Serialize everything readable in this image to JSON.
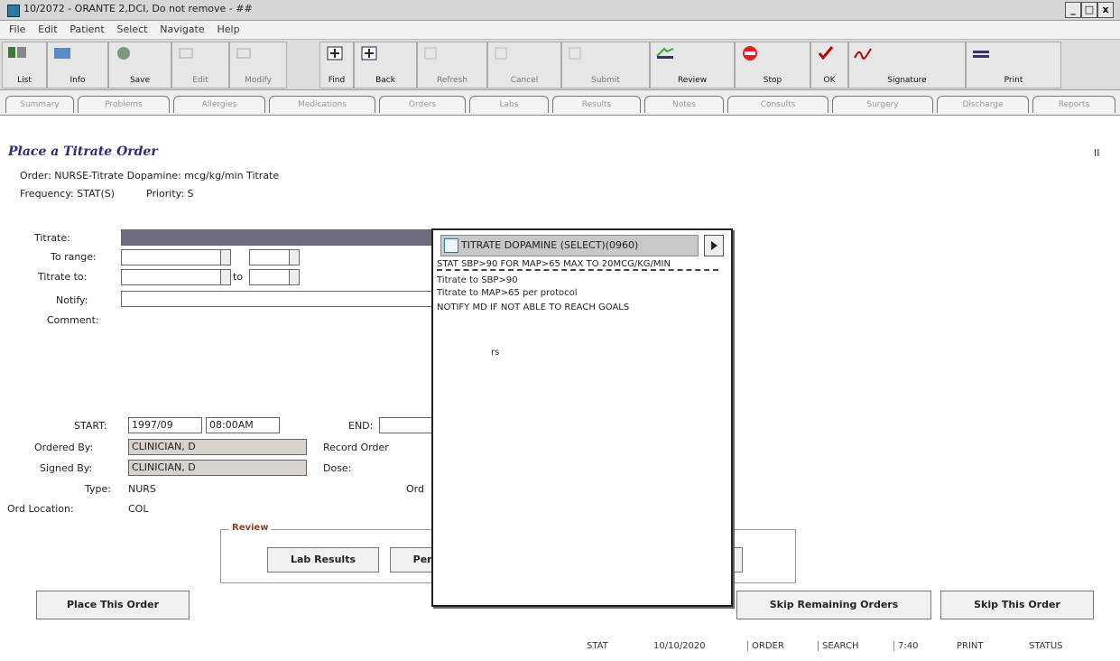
{
  "window": {
    "title": "10/2072 - ORANTE 2,DCI, Do not remove - ##",
    "min": "_",
    "max": "□",
    "close": "x"
  },
  "menu": [
    "File",
    "Edit",
    "Patient",
    "Select",
    "Navigate",
    "Help"
  ],
  "toolbar": [
    {
      "label": "List",
      "icon": "list-icon",
      "enabled": true
    },
    {
      "label": "Info",
      "icon": "info-icon",
      "enabled": true
    },
    {
      "label": "Save",
      "icon": "save-icon",
      "enabled": true
    },
    {
      "label": "Edit",
      "icon": "edit-icon",
      "enabled": false
    },
    {
      "label": "Modify",
      "icon": "modify-icon",
      "enabled": false
    },
    {
      "label": "Find",
      "icon": "find-icon",
      "enabled": true
    },
    {
      "label": "Back",
      "icon": "back-icon",
      "enabled": true
    },
    {
      "label": "Refresh",
      "icon": "refresh-icon",
      "enabled": false
    },
    {
      "label": "Cancel",
      "icon": "cancel-icon",
      "enabled": false
    },
    {
      "label": "Submit",
      "icon": "submit-icon",
      "enabled": false
    },
    {
      "label": "Review",
      "icon": "review-icon",
      "enabled": true
    },
    {
      "label": "Stop",
      "icon": "stop-icon",
      "enabled": true
    },
    {
      "label": "OK",
      "icon": "check-ok-icon",
      "enabled": true
    },
    {
      "label": "Signature",
      "icon": "signature-icon",
      "enabled": true
    },
    {
      "label": "Print",
      "icon": "print-icon",
      "enabled": true
    }
  ],
  "tabs": [
    "Summary",
    "Problems",
    "Allergies",
    "Medications",
    "Orders",
    "Labs",
    "Results",
    "Notes",
    "Consults",
    "Surgery",
    "Discharge",
    "Reports"
  ],
  "order": {
    "page_title": "Place a Titrate Order",
    "order_line": "Order: NURSE-Titrate Dopamine: mcg/kg/min Titrate",
    "frequency_line": "Frequency: STAT(S)          Priority: S",
    "page_marker": "II",
    "labels": {
      "titrate": "Titrate:",
      "to_range": "To range:",
      "titrate_to": "Titrate to:",
      "notify": "Notify:",
      "comment": "Comment:",
      "start": "START:",
      "end": "END:",
      "ordered_by": "Ordered By:",
      "signed_by": "Signed By:",
      "dose": "Dose:",
      "type": "Type:",
      "type_value": "NURS",
      "order_location": "Ord Location:",
      "order_location_value": "COL",
      "record_order": "Record Order",
      "route": "Ord"
    },
    "sep": "to",
    "start_date": "1997/09",
    "start_time": "08:00AM",
    "ordered_by": "CLINICIAN, D",
    "signed_by": "CLINICIAN, D"
  },
  "popup": {
    "header": "TITRATE DOPAMINE (SELECT)(0960)",
    "items": [
      "STAT SBP>90 FOR MAP>65 MAX TO 20MCG/KG/MIN",
      "Titrate to SBP>90",
      "Titrate to MAP>65 per protocol",
      "NOTIFY MD IF NOT ABLE TO REACH GOALS"
    ],
    "extra": "rs"
  },
  "review": {
    "label": "Review",
    "lab_results": "Lab Results",
    "pending": "Pending"
  },
  "buttons": {
    "place": "Place This Order",
    "skip_remaining": "Skip Remaining Orders",
    "skip_this": "Skip This Order"
  },
  "status": [
    "STAT",
    "10/10/2020",
    "ORDER",
    "SEARCH",
    "7:40",
    "PRINT",
    "STATUS"
  ]
}
